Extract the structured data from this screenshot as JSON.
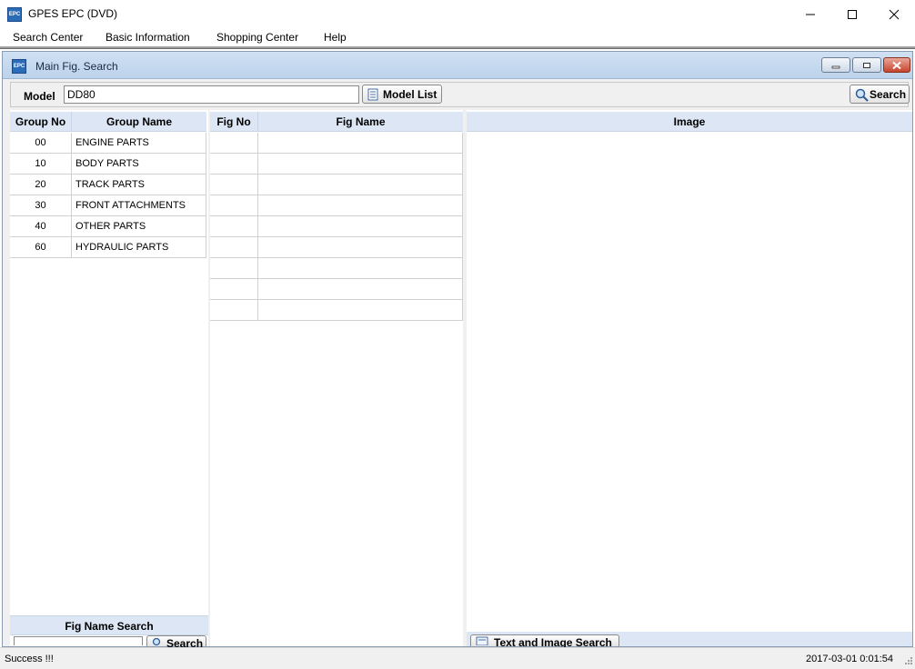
{
  "window": {
    "icon_text": "EPC",
    "title": "GPES EPC (DVD)"
  },
  "menu": [
    "Search Center",
    "Basic Information",
    "Shopping Center",
    "Help"
  ],
  "child": {
    "icon_text": "EPC",
    "title": "Main Fig. Search"
  },
  "model": {
    "label": "Model",
    "value": "DD80",
    "model_list_button": "Model List",
    "search_button": "Search"
  },
  "groups": {
    "headers": [
      "Group No",
      "Group Name"
    ],
    "rows": [
      {
        "no": "00",
        "name": "ENGINE PARTS"
      },
      {
        "no": "10",
        "name": "BODY PARTS"
      },
      {
        "no": "20",
        "name": "TRACK PARTS"
      },
      {
        "no": "30",
        "name": "FRONT ATTACHMENTS"
      },
      {
        "no": "40",
        "name": "OTHER PARTS"
      },
      {
        "no": "60",
        "name": "HYDRAULIC PARTS"
      }
    ],
    "fig_name_search_label": "Fig Name Search",
    "fig_name_search_button": "Search"
  },
  "figs": {
    "headers": [
      "Fig No",
      "Fig Name"
    ],
    "row_count": 9
  },
  "image": {
    "header": "Image",
    "text_image_search_button": "Text and Image Search"
  },
  "status": {
    "message": "Success !!!",
    "timestamp": "2017-03-01 0:01:54"
  },
  "colors": {
    "grid_header": "#dce6f4",
    "child_title": "#bcd3ec"
  }
}
